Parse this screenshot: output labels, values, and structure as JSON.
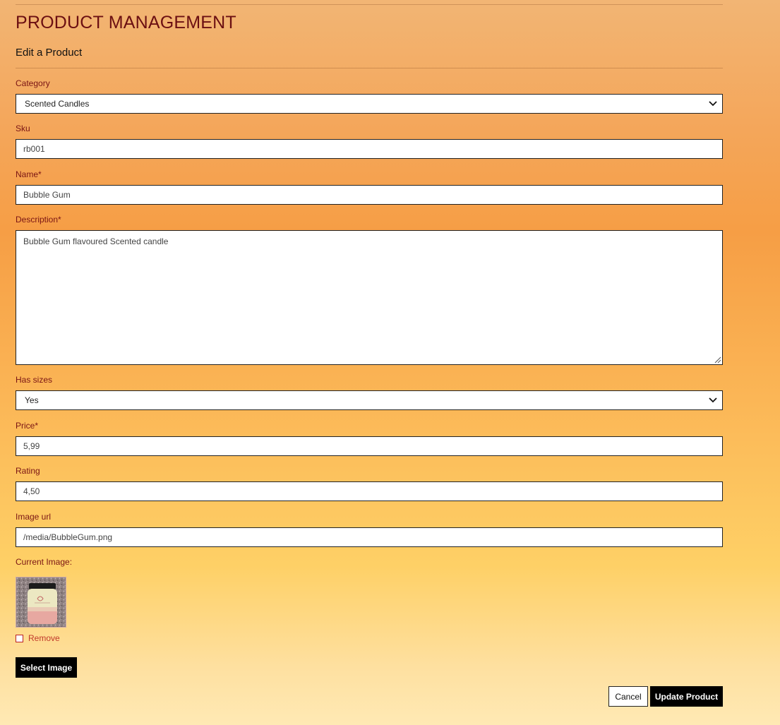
{
  "header": {
    "title": "PRODUCT MANAGEMENT",
    "subtitle": "Edit a Product"
  },
  "form": {
    "category": {
      "label": "Category",
      "value": "Scented Candles"
    },
    "sku": {
      "label": "Sku",
      "value": "rb001"
    },
    "name": {
      "label": "Name*",
      "value": "Bubble Gum"
    },
    "description": {
      "label": "Description*",
      "value": "Bubble Gum flavoured Scented candle"
    },
    "has_sizes": {
      "label": "Has sizes",
      "value": "Yes"
    },
    "price": {
      "label": "Price*",
      "value": "5,99"
    },
    "rating": {
      "label": "Rating",
      "value": "4,50"
    },
    "image_url": {
      "label": "Image url",
      "value": "/media/BubbleGum.png"
    },
    "current_image": {
      "label": "Current Image:"
    },
    "remove": {
      "label": "Remove"
    },
    "select_image_label": "Select Image"
  },
  "actions": {
    "cancel_label": "Cancel",
    "update_label": "Update Product"
  },
  "colors": {
    "label": "#7a1414",
    "title": "#6b0f12",
    "remove": "#c0392b",
    "button_dark": "#000000"
  }
}
